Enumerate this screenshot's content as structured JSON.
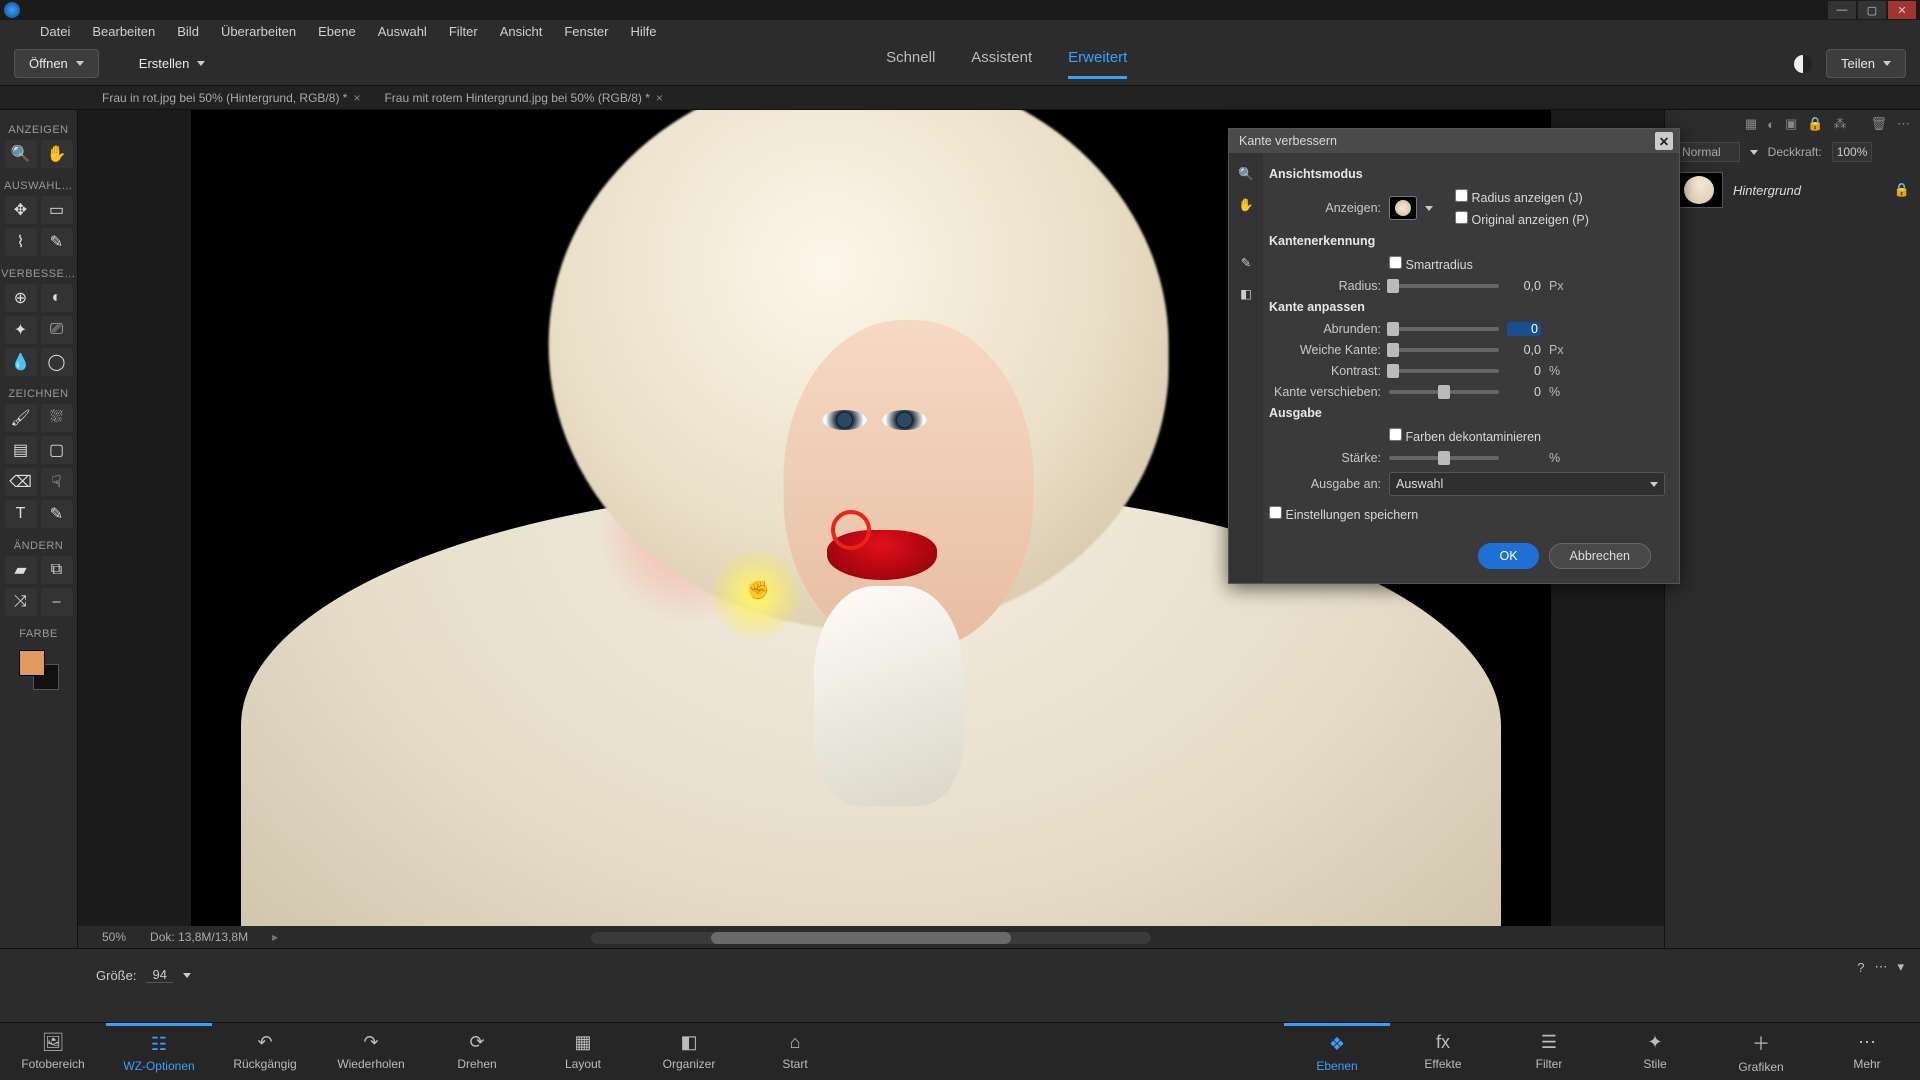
{
  "menubar": [
    "Datei",
    "Bearbeiten",
    "Bild",
    "Überarbeiten",
    "Ebene",
    "Auswahl",
    "Filter",
    "Ansicht",
    "Fenster",
    "Hilfe"
  ],
  "actionbar": {
    "open": "Öffnen",
    "create": "Erstellen",
    "modes": {
      "quick": "Schnell",
      "guided": "Assistent",
      "expert": "Erweitert"
    },
    "share": "Teilen"
  },
  "doc_tabs": [
    "Frau in rot.jpg bei 50% (Hintergrund, RGB/8) *",
    "Frau mit rotem Hintergrund.jpg bei 50% (RGB/8) *"
  ],
  "tool_sections": {
    "anzeigen": "ANZEIGEN",
    "auswahl": "AUSWAHL…",
    "verbessern": "VERBESSE…",
    "zeichnen": "ZEICHNEN",
    "aendern": "ÄNDERN",
    "farbe": "FARBE"
  },
  "layers": {
    "blend_label": "Normal",
    "opacity_label": "Deckkraft:",
    "opacity_value": "100%",
    "layer_name": "Hintergrund"
  },
  "canvas_status": {
    "zoom": "50%",
    "doc": "Dok: 13,8M/13,8M"
  },
  "tool_options": {
    "size_label": "Größe:",
    "size_value": "94"
  },
  "dialog": {
    "title": "Kante verbessern",
    "view_mode": "Ansichtsmodus",
    "view_label": "Anzeigen:",
    "show_radius": "Radius anzeigen (J)",
    "show_original": "Original anzeigen (P)",
    "edge_detection": "Kantenerkennung",
    "smart_radius": "Smartradius",
    "radius_label": "Radius:",
    "radius_value": "0,0",
    "px": "Px",
    "adjust_edge": "Kante anpassen",
    "smooth_label": "Abrunden:",
    "smooth_value": "0",
    "feather_label": "Weiche Kante:",
    "feather_value": "0,0",
    "contrast_label": "Kontrast:",
    "contrast_value": "0",
    "percent": "%",
    "shift_label": "Kante verschieben:",
    "shift_value": "0",
    "output": "Ausgabe",
    "decon": "Farben dekontaminieren",
    "amount_label": "Stärke:",
    "output_to_label": "Ausgabe an:",
    "output_to_value": "Auswahl",
    "remember": "Einstellungen speichern",
    "ok": "OK",
    "cancel": "Abbrechen"
  },
  "bottom_left": [
    "Fotobereich",
    "WZ-Optionen",
    "Rückgängig",
    "Wiederholen",
    "Drehen",
    "Layout",
    "Organizer",
    "Start"
  ],
  "bottom_right": [
    "Ebenen",
    "Effekte",
    "Filter",
    "Stile",
    "Grafiken",
    "Mehr"
  ]
}
